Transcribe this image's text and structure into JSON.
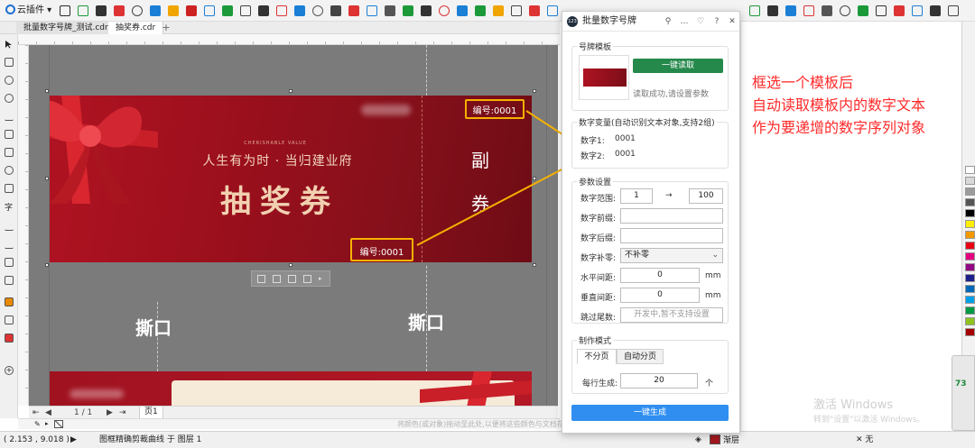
{
  "toolbar": {
    "plugin_menu_label": "云插件"
  },
  "doc_tabs": [
    {
      "label": "批量数字号牌_测试.cdr"
    },
    {
      "label": "抽奖券.cdr"
    }
  ],
  "ticket": {
    "tagline": "CHERISHABLE VALUE",
    "slogan": "人生有为时 · 当归建业府",
    "title": "抽奖券",
    "stub_top": "副",
    "stub_bottom": "券",
    "number_label_1": "编号:0001",
    "number_label_2": "编号:0001"
  },
  "canvas": {
    "tear_label_left": "撕口",
    "tear_label_right": "撕口"
  },
  "page_nav": {
    "page_counter": "1 / 1",
    "page_tab": "页1"
  },
  "palette_hint": "将颜色(或对象)拖动至此处,以便将这些颜色与文档存储在一起",
  "status_bar": {
    "coords": "( 2.153 , 9.018 )",
    "object_info": "图框精确剪裁曲线 于 图层 1",
    "fill_label": "渐层",
    "outline_label": "无"
  },
  "annotation": {
    "line1": "框选一个模板后",
    "line2": "自动读取模板内的数字文本",
    "line3": "作为要递增的数字序列对象"
  },
  "watermark": {
    "line1": "激活 Windows",
    "line2": "转到\"设置\"以激活 Windows。"
  },
  "gauge": {
    "value": "73"
  },
  "panel": {
    "title": "批量数字号牌",
    "app_icon_text": "123",
    "template": {
      "label": "号牌模板",
      "read_button": "一键读取",
      "status": "读取成功,请设置参数"
    },
    "variables": {
      "label": "数字变量(自动识别文本对象,支持2组)",
      "items": [
        {
          "name": "数字1:",
          "value": "0001"
        },
        {
          "name": "数字2:",
          "value": "0001"
        }
      ]
    },
    "params": {
      "label": "参数设置",
      "range_label": "数字范围:",
      "range_start": "1",
      "range_arrow": "→",
      "range_end": "100",
      "prefix_label": "数字前缀:",
      "prefix_value": "",
      "suffix_label": "数字后缀:",
      "suffix_value": "",
      "pad_label": "数字补零:",
      "pad_value": "不补零",
      "h_spacing_label": "水平间距:",
      "h_spacing_value": "0",
      "h_spacing_unit": "mm",
      "v_spacing_label": "垂直间距:",
      "v_spacing_value": "0",
      "v_spacing_unit": "mm",
      "skip_label": "跳过尾数:",
      "skip_placeholder": "开发中,暂不支持设置"
    },
    "mode": {
      "label": "制作模式",
      "tabs": [
        "不分页",
        "自动分页"
      ],
      "per_row_label": "每行生成:",
      "per_row_value": "20",
      "per_row_unit": "个"
    },
    "generate_button": "一键生成"
  },
  "colors": {
    "accent_blue": "#2f8ef0",
    "accent_green": "#25894b",
    "highlight_yellow": "#f6b100",
    "annotation_red": "#ff2a2a",
    "ticket_red": "#a3171e"
  }
}
